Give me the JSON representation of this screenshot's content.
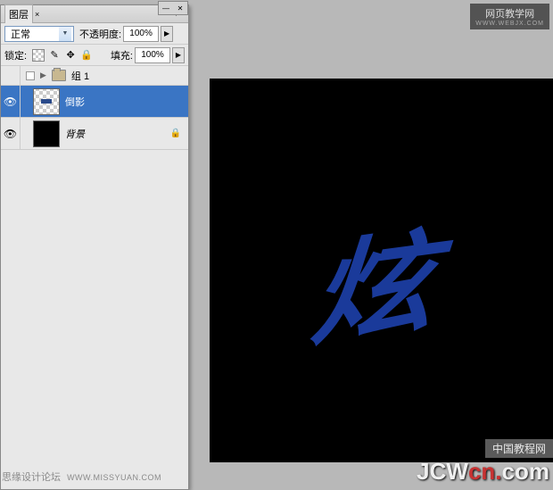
{
  "panel": {
    "tab_label": "图层",
    "blend_mode": "正常",
    "opacity_label": "不透明度:",
    "opacity_value": "100%",
    "lock_label": "锁定:",
    "fill_label": "填充:",
    "fill_value": "100%"
  },
  "layers": {
    "group": {
      "name": "组 1",
      "expanded": true
    },
    "items": [
      {
        "name": "倒影",
        "visible": true,
        "selected": true,
        "thumb": "transparency"
      },
      {
        "name": "背景",
        "visible": true,
        "selected": false,
        "thumb": "black",
        "locked": true
      }
    ]
  },
  "canvas": {
    "character": "炫"
  },
  "watermarks": {
    "top_right": {
      "title": "网页教学网",
      "sub": "WWW.WEBJX.COM"
    },
    "bottom_right": {
      "badge": "中国教程网",
      "main_a": "JCW",
      "main_b": "cn",
      "dot": ".",
      "main_c": "com"
    },
    "bottom_left": {
      "text": "思缘设计论坛",
      "url": "WWW.MISSYUAN.COM"
    }
  }
}
